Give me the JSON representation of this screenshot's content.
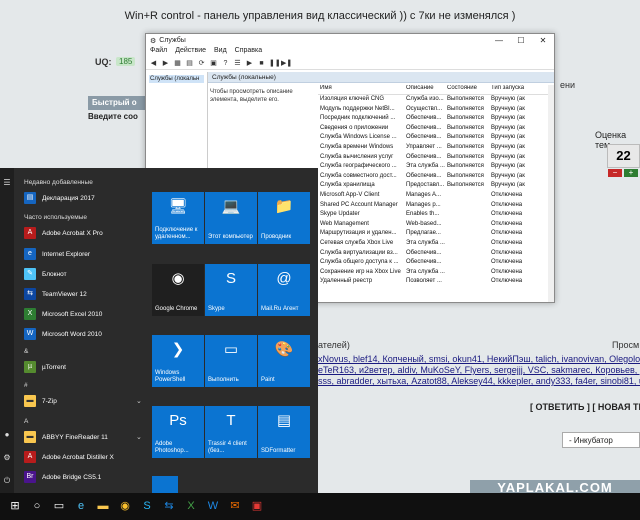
{
  "forum": {
    "topic_title": "Win+R control - панель управления вид классический )) с 7ки не изменялся )",
    "uq_label": "UQ:",
    "uq_value": "185",
    "quick_reply": "Быстрый о",
    "enter_text": "Введите соо",
    "services_tail": "ени",
    "rating_label": "Оценка тем",
    "rating_value": "22",
    "rating_minus": "−",
    "rating_plus": "+",
    "readers_label": "ателей)",
    "views_label": "Просм",
    "users_lines": [
      "xNovus, blef14, Копченый, smsi, okun41, НекийПэш, talich, ivanovivan, Olegolos",
      "eTeR163, и2ветер, aldiv, MuKoSeY, Flyers, sergejjj, VSC, sakmarec, Коровьев, ровь",
      "sss, abradder, хытьха, Azatot88, Aleksey44, kkkepler, andy333, fa4er, sinobi81, u"
    ],
    "reply_links": "[ ОТВЕТИТЬ ] [ НОВАЯ ТЕ",
    "incubator": "- Инкубатор",
    "watermark": "YAPLAKAL.COM"
  },
  "services_window": {
    "title": "Службы",
    "win_controls": [
      "—",
      "☐",
      "✕"
    ],
    "menu": [
      "Файл",
      "Действие",
      "Вид",
      "Справка"
    ],
    "tree_item": "Службы (локальн",
    "header": "Службы (локальные)",
    "description_hint": "Чтобы просмотреть описание элемента, выделите его.",
    "columns": [
      "Имя",
      "Описание",
      "Состояние",
      "Тип запуска"
    ],
    "rows": [
      {
        "name": "Изоляция ключей CNG",
        "desc": "Служба изо...",
        "state": "Выполняется",
        "start": "Вручную (ак"
      },
      {
        "name": "Модуль поддержки NetBI...",
        "desc": "Осуществл...",
        "state": "Выполняется",
        "start": "Вручную (ак"
      },
      {
        "name": "Посредник подключений ...",
        "desc": "Обеспечив...",
        "state": "Выполняется",
        "start": "Вручную (ак"
      },
      {
        "name": "Сведения о приложении",
        "desc": "Обеспечив...",
        "state": "Выполняется",
        "start": "Вручную (ак"
      },
      {
        "name": "Служба Windows License ...",
        "desc": "Обеспечив...",
        "state": "Выполняется",
        "start": "Вручную (ак"
      },
      {
        "name": "Служба времени Windows",
        "desc": "Управляет ...",
        "state": "Выполняется",
        "start": "Вручную (ак"
      },
      {
        "name": "Служба вычисления услуг",
        "desc": "Обеспечив...",
        "state": "Выполняется",
        "start": "Вручную (ак"
      },
      {
        "name": "Служба географического ...",
        "desc": "Эта служба ...",
        "state": "Выполняется",
        "start": "Вручную (ак"
      },
      {
        "name": "Служба совместного дост...",
        "desc": "Обеспечив...",
        "state": "Выполняется",
        "start": "Вручную (ак"
      },
      {
        "name": "Служба хранилища",
        "desc": "Предоставл...",
        "state": "Выполняется",
        "start": "Вручную (ак"
      },
      {
        "name": "Microsoft App-V Client",
        "desc": "Manages A...",
        "state": "",
        "start": "Отключена"
      },
      {
        "name": "Shared PC Account Manager",
        "desc": "Manages p...",
        "state": "",
        "start": "Отключена"
      },
      {
        "name": "Skype Updater",
        "desc": "Enables th...",
        "state": "",
        "start": "Отключена"
      },
      {
        "name": "Web Management",
        "desc": "Web-based...",
        "state": "",
        "start": "Отключена"
      },
      {
        "name": "Маршрутизация и удален...",
        "desc": "Предлагае...",
        "state": "",
        "start": "Отключена"
      },
      {
        "name": "Сетевая служба Xbox Live",
        "desc": "Эта служба ...",
        "state": "",
        "start": "Отключена"
      },
      {
        "name": "Служба виртуализации вз...",
        "desc": "Обеспечив...",
        "state": "",
        "start": "Отключена"
      },
      {
        "name": "Служба общего доступа к ...",
        "desc": "Обеспечив...",
        "state": "",
        "start": "Отключена"
      },
      {
        "name": "Сохранение игр на Xbox Live",
        "desc": "Эта служба ...",
        "state": "",
        "start": "Отключена"
      },
      {
        "name": "Удаленный реестр",
        "desc": "Позволяет ...",
        "state": "",
        "start": "Отключена"
      }
    ]
  },
  "start_menu": {
    "recent_header": "Недавно добавленные",
    "recent_items": [
      "Декларация 2017"
    ],
    "frequent_header": "Часто используемые",
    "frequent_items": [
      "Adobe Acrobat X Pro",
      "Internet Explorer",
      "Блокнот",
      "TeamViewer 12",
      "Microsoft Excel 2010",
      "Microsoft Word 2010"
    ],
    "group_amp": "&",
    "utorrent": "µTorrent",
    "group_hash": "#",
    "zip": "7-Zip",
    "group_a": "A",
    "a_items": [
      "ABBYY FineReader 11",
      "Adobe Acrobat Distiller X",
      "Adobe Bridge CS5.1"
    ],
    "tiles": [
      {
        "label": "Подключение к удаленном...",
        "icon": "🖥",
        "color": "#0b74d1"
      },
      {
        "label": "Этот компьютер",
        "icon": "💻",
        "color": "#0b74d1"
      },
      {
        "label": "Проводник",
        "icon": "📁",
        "color": "#0b74d1"
      },
      {
        "label": "Google Chrome",
        "icon": "◉",
        "color": "#1f1f1f"
      },
      {
        "label": "Skype",
        "icon": "S",
        "color": "#0b74d1"
      },
      {
        "label": "Mail.Ru Агент",
        "icon": "@",
        "color": "#0b74d1"
      },
      {
        "label": "Windows PowerShell",
        "icon": "❯",
        "color": "#0b74d1"
      },
      {
        "label": "Выполнить",
        "icon": "▭",
        "color": "#0b74d1"
      },
      {
        "label": "Paint",
        "icon": "🎨",
        "color": "#0b74d1"
      },
      {
        "label": "Adobe Photoshop...",
        "icon": "Ps",
        "color": "#0b74d1"
      },
      {
        "label": "Trassir 4 client (без...",
        "icon": "T",
        "color": "#0b74d1"
      },
      {
        "label": "SDFormatter",
        "icon": "▤",
        "color": "#0b74d1"
      }
    ]
  },
  "taskbar": {
    "icons": [
      "windows-logo",
      "search",
      "task-view",
      "edge",
      "explorer",
      "chrome",
      "skype",
      "teamviewer",
      "excel",
      "word",
      "mail",
      "app"
    ]
  }
}
